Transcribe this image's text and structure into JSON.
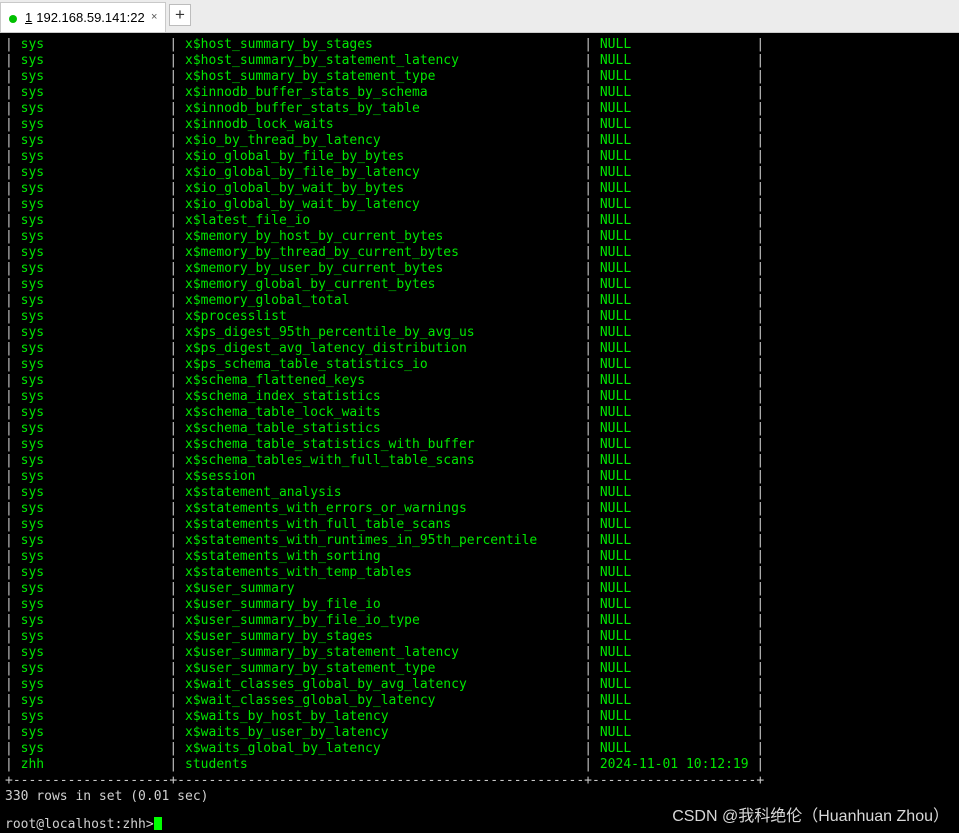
{
  "colors": {
    "accent": "#00ff00",
    "row_text": "#00e600",
    "border_text": "#c8c8c8",
    "summary_text": "#d0d0d0",
    "background": "#000000",
    "status_dot": "#00c000"
  },
  "tab": {
    "index": "1",
    "title": "192.168.59.141:22",
    "close_icon": "×",
    "new_tab_icon": "+"
  },
  "table": {
    "rows": [
      [
        "sys",
        "x$host_summary_by_stages",
        "NULL"
      ],
      [
        "sys",
        "x$host_summary_by_statement_latency",
        "NULL"
      ],
      [
        "sys",
        "x$host_summary_by_statement_type",
        "NULL"
      ],
      [
        "sys",
        "x$innodb_buffer_stats_by_schema",
        "NULL"
      ],
      [
        "sys",
        "x$innodb_buffer_stats_by_table",
        "NULL"
      ],
      [
        "sys",
        "x$innodb_lock_waits",
        "NULL"
      ],
      [
        "sys",
        "x$io_by_thread_by_latency",
        "NULL"
      ],
      [
        "sys",
        "x$io_global_by_file_by_bytes",
        "NULL"
      ],
      [
        "sys",
        "x$io_global_by_file_by_latency",
        "NULL"
      ],
      [
        "sys",
        "x$io_global_by_wait_by_bytes",
        "NULL"
      ],
      [
        "sys",
        "x$io_global_by_wait_by_latency",
        "NULL"
      ],
      [
        "sys",
        "x$latest_file_io",
        "NULL"
      ],
      [
        "sys",
        "x$memory_by_host_by_current_bytes",
        "NULL"
      ],
      [
        "sys",
        "x$memory_by_thread_by_current_bytes",
        "NULL"
      ],
      [
        "sys",
        "x$memory_by_user_by_current_bytes",
        "NULL"
      ],
      [
        "sys",
        "x$memory_global_by_current_bytes",
        "NULL"
      ],
      [
        "sys",
        "x$memory_global_total",
        "NULL"
      ],
      [
        "sys",
        "x$processlist",
        "NULL"
      ],
      [
        "sys",
        "x$ps_digest_95th_percentile_by_avg_us",
        "NULL"
      ],
      [
        "sys",
        "x$ps_digest_avg_latency_distribution",
        "NULL"
      ],
      [
        "sys",
        "x$ps_schema_table_statistics_io",
        "NULL"
      ],
      [
        "sys",
        "x$schema_flattened_keys",
        "NULL"
      ],
      [
        "sys",
        "x$schema_index_statistics",
        "NULL"
      ],
      [
        "sys",
        "x$schema_table_lock_waits",
        "NULL"
      ],
      [
        "sys",
        "x$schema_table_statistics",
        "NULL"
      ],
      [
        "sys",
        "x$schema_table_statistics_with_buffer",
        "NULL"
      ],
      [
        "sys",
        "x$schema_tables_with_full_table_scans",
        "NULL"
      ],
      [
        "sys",
        "x$session",
        "NULL"
      ],
      [
        "sys",
        "x$statement_analysis",
        "NULL"
      ],
      [
        "sys",
        "x$statements_with_errors_or_warnings",
        "NULL"
      ],
      [
        "sys",
        "x$statements_with_full_table_scans",
        "NULL"
      ],
      [
        "sys",
        "x$statements_with_runtimes_in_95th_percentile",
        "NULL"
      ],
      [
        "sys",
        "x$statements_with_sorting",
        "NULL"
      ],
      [
        "sys",
        "x$statements_with_temp_tables",
        "NULL"
      ],
      [
        "sys",
        "x$user_summary",
        "NULL"
      ],
      [
        "sys",
        "x$user_summary_by_file_io",
        "NULL"
      ],
      [
        "sys",
        "x$user_summary_by_file_io_type",
        "NULL"
      ],
      [
        "sys",
        "x$user_summary_by_stages",
        "NULL"
      ],
      [
        "sys",
        "x$user_summary_by_statement_latency",
        "NULL"
      ],
      [
        "sys",
        "x$user_summary_by_statement_type",
        "NULL"
      ],
      [
        "sys",
        "x$wait_classes_global_by_avg_latency",
        "NULL"
      ],
      [
        "sys",
        "x$wait_classes_global_by_latency",
        "NULL"
      ],
      [
        "sys",
        "x$waits_by_host_by_latency",
        "NULL"
      ],
      [
        "sys",
        "x$waits_by_user_by_latency",
        "NULL"
      ],
      [
        "sys",
        "x$waits_global_by_latency",
        "NULL"
      ],
      [
        "zhh",
        "students",
        "2024-11-01 10:12:19"
      ]
    ],
    "bottom_border": "+--------------------+----------------------------------------------------+---------------------+",
    "summary": "330 rows in set (0.01 sec)"
  },
  "prompt": {
    "text": "root@localhost:zhh>"
  },
  "watermark": {
    "text": "CSDN @我科绝伦（Huanhuan Zhou）"
  }
}
